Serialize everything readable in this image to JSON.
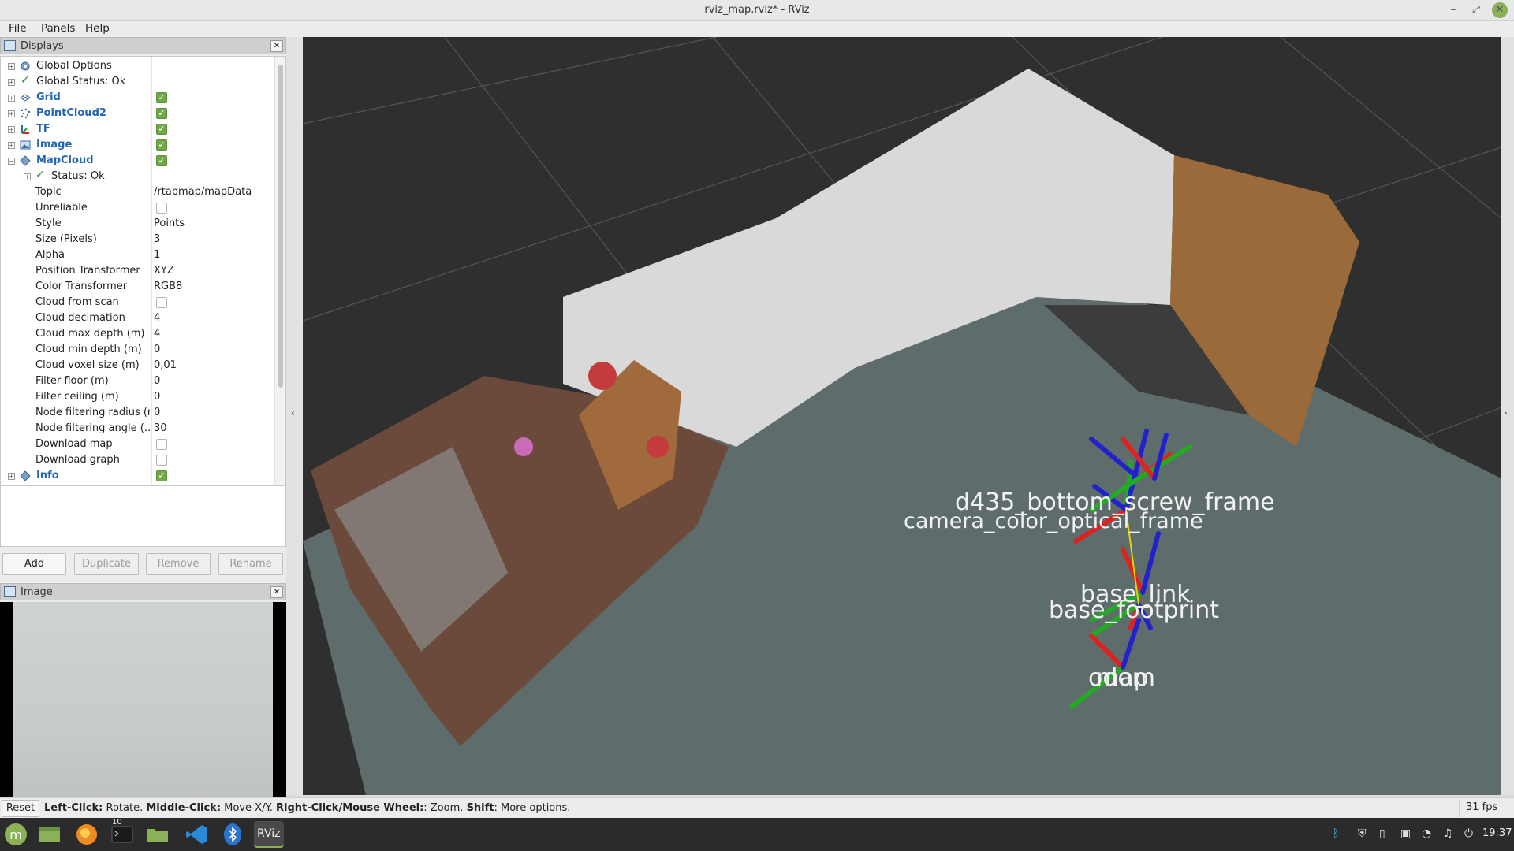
{
  "window": {
    "title": "rviz_map.rviz* - RViz"
  },
  "menu": [
    "File",
    "Panels",
    "Help"
  ],
  "displays_panel": {
    "title": "Displays",
    "rows": [
      {
        "label": "Global Options"
      },
      {
        "label": "Global Status: Ok"
      },
      {
        "label": "Grid",
        "checked": true
      },
      {
        "label": "PointCloud2",
        "checked": true
      },
      {
        "label": "TF",
        "checked": true
      },
      {
        "label": "Image",
        "checked": true
      },
      {
        "label": "MapCloud",
        "checked": true
      },
      {
        "label": "Status: Ok"
      }
    ],
    "properties": [
      {
        "name": "Topic",
        "value": "/rtabmap/mapData"
      },
      {
        "name": "Unreliable",
        "checkbox": false
      },
      {
        "name": "Style",
        "value": "Points"
      },
      {
        "name": "Size (Pixels)",
        "value": "3"
      },
      {
        "name": "Alpha",
        "value": "1"
      },
      {
        "name": "Position Transformer",
        "value": "XYZ"
      },
      {
        "name": "Color Transformer",
        "value": "RGB8"
      },
      {
        "name": "Cloud from scan",
        "checkbox": false
      },
      {
        "name": "Cloud decimation",
        "value": "4"
      },
      {
        "name": "Cloud max depth (m)",
        "value": "4"
      },
      {
        "name": "Cloud min depth (m)",
        "value": "0"
      },
      {
        "name": "Cloud voxel size (m)",
        "value": "0,01"
      },
      {
        "name": "Filter floor (m)",
        "value": "0"
      },
      {
        "name": "Filter ceiling (m)",
        "value": "0"
      },
      {
        "name": "Node filtering radius (m)",
        "value": "0"
      },
      {
        "name": "Node filtering angle (…",
        "value": "30"
      },
      {
        "name": "Download map",
        "checkbox": false
      },
      {
        "name": "Download graph",
        "checkbox": false
      }
    ],
    "last_row": {
      "label": "Info",
      "checked": true
    },
    "buttons": {
      "add": "Add",
      "duplicate": "Duplicate",
      "remove": "Remove",
      "rename": "Rename"
    }
  },
  "image_panel": {
    "title": "Image"
  },
  "viewport": {
    "tf_labels": {
      "screw_frame": "d435_bottom_screw_frame",
      "camera_frames": "camera_color_optical_frame",
      "base_link": "base_link",
      "base_footprint": "base_footprint",
      "odom": "odom",
      "map": "map"
    },
    "colors": {
      "background": "#2f2f2f",
      "floor": "#5e6d6c",
      "grid": "#7a7a7a"
    }
  },
  "statusbar": {
    "reset": "Reset",
    "hint": [
      {
        "bold": "Left-Click:",
        "text": " Rotate. "
      },
      {
        "bold": "Middle-Click:",
        "text": " Move X/Y. "
      },
      {
        "bold": "Right-Click/Mouse Wheel:",
        "text": ": Zoom. "
      },
      {
        "bold": "Shift",
        "text": ": More options."
      }
    ],
    "fps": "31 fps"
  },
  "taskbar": {
    "terminal_badge": "10",
    "clock": "19:37",
    "rviz_label": "RViz"
  }
}
